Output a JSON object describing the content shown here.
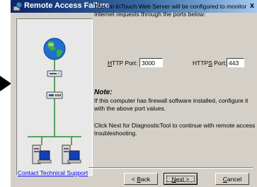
{
  "window": {
    "title": "Remote Access Failure",
    "close_glyph": "x"
  },
  "content": {
    "intro": "The I'm InTouch Web Server will be configured to monitor Internet requests through the ports below:",
    "http_label_underlined": "H",
    "http_label_rest": "TTP Port:",
    "http_port": "3000",
    "https_label_before": "HTTP",
    "https_label_underlined": "S",
    "https_label_after": " Port:",
    "https_port": "443",
    "note_heading": "Note:",
    "note_body": "If this computer has firewall software installed, configure it with the above port values.",
    "next_instruction": "Click Next for DiagnosticTool to continue with remote access troubleshooting."
  },
  "footer": {
    "support_link": "Contact Technical Support",
    "back_prefix": "< ",
    "back_underlined": "B",
    "back_rest": "ack",
    "next_underlined": "N",
    "next_rest": "ext >",
    "cancel_underlined": "C",
    "cancel_rest": "ancel"
  },
  "icons": {
    "pointer": "arrow-pointer-icon",
    "title": "network-globe-icon",
    "globe": "globe-icon",
    "router": "router-icon",
    "hub": "hub-icon",
    "computers": "desktop-computer-icon"
  },
  "colors": {
    "titlebar_start": "#0a246a",
    "titlebar_end": "#a6caf0",
    "dialog_bg": "#d4d0c8",
    "network_line": "#2e8b2e",
    "link": "#0000ff"
  }
}
